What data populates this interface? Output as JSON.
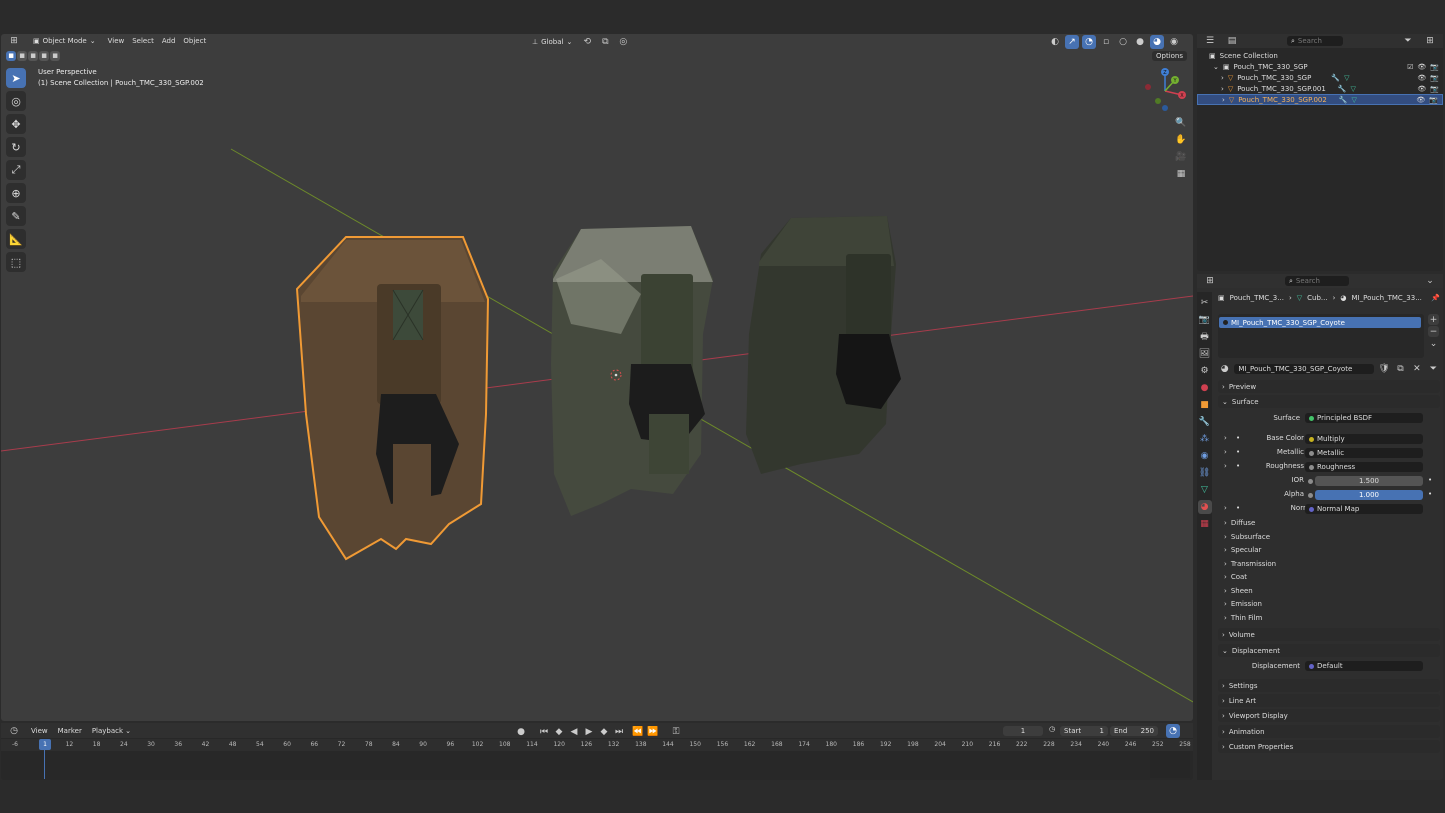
{
  "viewport": {
    "mode": "Object Mode",
    "menus": [
      "View",
      "Select",
      "Add",
      "Object"
    ],
    "orientation": "Global",
    "options": "Options",
    "overlay_title": "User Perspective",
    "overlay_sub": "(1) Scene Collection | Pouch_TMC_330_SGP.002",
    "gizmo": {
      "x": "X",
      "y": "Y",
      "z": "Z"
    }
  },
  "outliner": {
    "search_placeholder": "Search",
    "root": "Scene Collection",
    "collection": "Pouch_TMC_330_SGP",
    "items": [
      "Pouch_TMC_330_SGP",
      "Pouch_TMC_330_SGP.001",
      "Pouch_TMC_330_SGP.002"
    ]
  },
  "properties": {
    "search_placeholder": "Search",
    "breadcrumb": [
      "Pouch_TMC_3...",
      "Cub...",
      "MI_Pouch_TMC_33..."
    ],
    "slot": "MI_Pouch_TMC_330_SGP_Coyote",
    "material": "MI_Pouch_TMC_330_SGP_Coyote",
    "sections": {
      "preview": "Preview",
      "surface": "Surface",
      "volume": "Volume",
      "displacement": "Displacement",
      "settings": "Settings",
      "line_art": "Line Art",
      "viewport_display": "Viewport Display",
      "animation": "Animation",
      "custom": "Custom Properties"
    },
    "surface_label": "Surface",
    "surface_value": "Principled BSDF",
    "inputs": [
      {
        "label": "Base Color",
        "value": "Multiply",
        "color": "#c7b31f"
      },
      {
        "label": "Metallic",
        "value": "Metallic",
        "color": "#8d8d8d"
      },
      {
        "label": "Roughness",
        "value": "Roughness",
        "color": "#8d8d8d"
      }
    ],
    "ior": {
      "label": "IOR",
      "value": "1.500"
    },
    "alpha": {
      "label": "Alpha",
      "value": "1.000"
    },
    "normal": {
      "label": "Normal",
      "value": "Normal Map",
      "color": "#6363c7"
    },
    "subpanels": [
      "Diffuse",
      "Subsurface",
      "Specular",
      "Transmission",
      "Coat",
      "Sheen",
      "Emission",
      "Thin Film"
    ],
    "displacement_label": "Displacement",
    "displacement_value": "Default"
  },
  "timeline": {
    "menus": [
      "View",
      "Marker",
      "Playback"
    ],
    "current": "1",
    "start_label": "Start",
    "start": "1",
    "end_label": "End",
    "end": "250",
    "frame_badge": "1",
    "ticks": [
      "-6",
      "6",
      "12",
      "18",
      "24",
      "30",
      "36",
      "42",
      "48",
      "54",
      "60",
      "66",
      "72",
      "78",
      "84",
      "90",
      "96",
      "102",
      "108",
      "114",
      "120",
      "126",
      "132",
      "138",
      "144",
      "150",
      "156",
      "162",
      "168",
      "174",
      "180",
      "186",
      "192",
      "198",
      "204",
      "210",
      "216",
      "222",
      "228",
      "234",
      "240",
      "246",
      "252",
      "258"
    ]
  },
  "colors": {
    "accent": "#4772b3",
    "selection": "#f09a35",
    "x_axis": "#a83c4c",
    "y_axis": "#6d8a2a"
  }
}
